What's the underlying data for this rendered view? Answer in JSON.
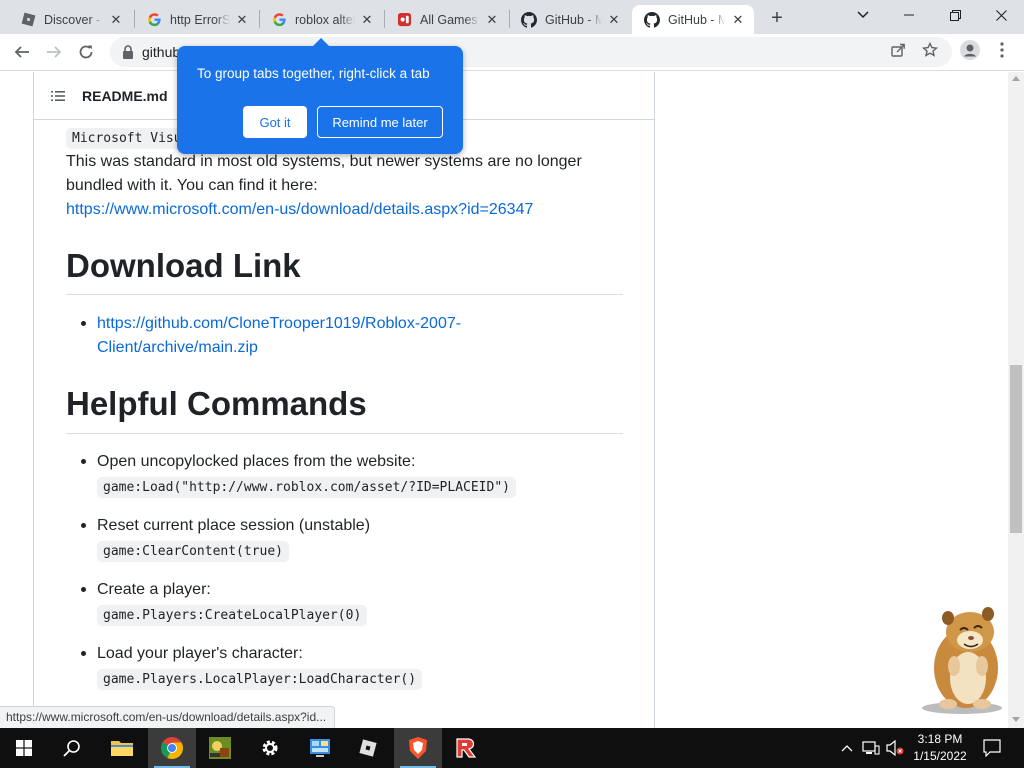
{
  "browser": {
    "tabs": [
      {
        "title": "Discover - R",
        "favicon": "roblox-icon"
      },
      {
        "title": "http ErrorS",
        "favicon": "google-icon"
      },
      {
        "title": "roblox alter",
        "favicon": "google-icon"
      },
      {
        "title": "All Games",
        "favicon": "game-icon"
      },
      {
        "title": "GitHub - M",
        "favicon": "github-icon"
      },
      {
        "title": "GitHub - M",
        "favicon": "github-icon"
      }
    ],
    "new_tab_label": "+",
    "address": "github",
    "accent_color": "#1a73e8"
  },
  "promo": {
    "message": "To group tabs together, right-click a tab",
    "got_it": "Got it",
    "remind_later": "Remind me later"
  },
  "readme": {
    "filename": "README.md",
    "code_fragment": "Microsoft Visu",
    "paragraph_line1": "This was standard in most old systems, but newer systems are no longer",
    "paragraph_line2": "bundled with it. You can find it here:",
    "ms_link": "https://www.microsoft.com/en-us/download/details.aspx?id=26347",
    "download_heading": "Download Link",
    "download_link_line1": "https://github.com/CloneTrooper1019/Roblox-2007-",
    "download_link_line2": "Client/archive/main.zip",
    "commands_heading": "Helpful Commands",
    "commands": [
      {
        "text": "Open uncopylocked places from the website:",
        "code": "game:Load(\"http://www.roblox.com/asset/?ID=PLACEID\")"
      },
      {
        "text": "Reset current place session (unstable)",
        "code": "game:ClearContent(true)"
      },
      {
        "text": "Create a player:",
        "code": "game.Players:CreateLocalPlayer(0)"
      },
      {
        "text": "Load your player's character:",
        "code": "game.Players.LocalPlayer:LoadCharacter()"
      }
    ]
  },
  "status_bar": "https://www.microsoft.com/en-us/download/details.aspx?id...",
  "taskbar": {
    "time": "3:18 PM",
    "date": "1/15/2022"
  }
}
